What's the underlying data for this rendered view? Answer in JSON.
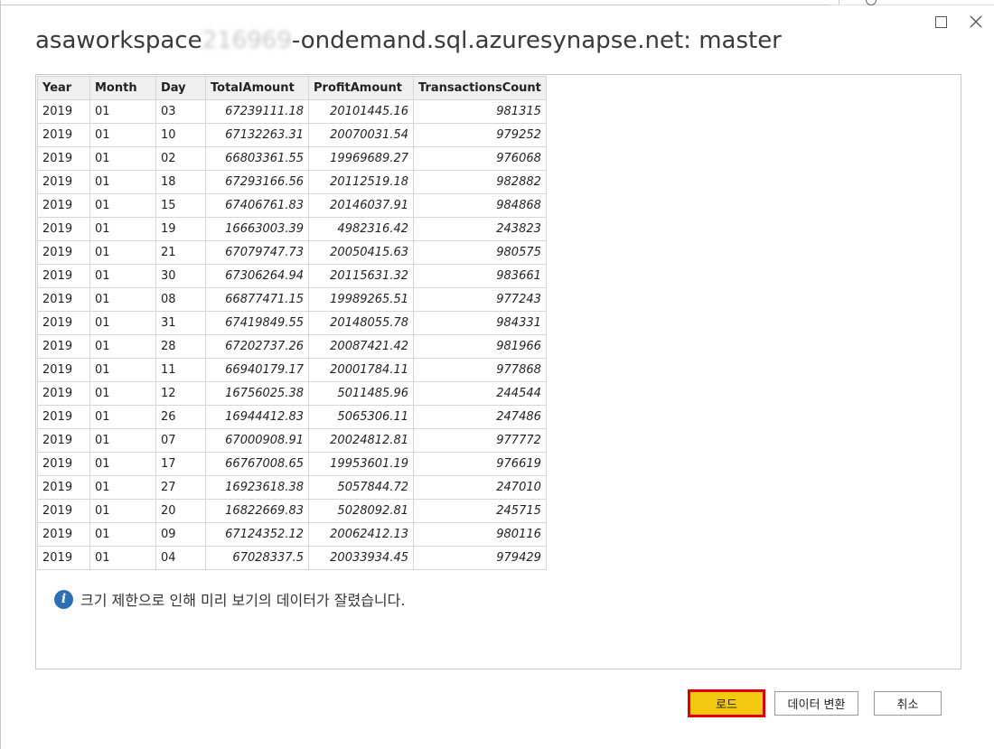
{
  "window": {
    "title_prefix": "asaworkspace",
    "title_redacted": "216969",
    "title_suffix": "-ondemand.sql.azuresynapse.net: master"
  },
  "table": {
    "columns": [
      "Year",
      "Month",
      "Day",
      "TotalAmount",
      "ProfitAmount",
      "TransactionsCount"
    ],
    "rows": [
      [
        "2019",
        "01",
        "03",
        "67239111.18",
        "20101445.16",
        "981315"
      ],
      [
        "2019",
        "01",
        "10",
        "67132263.31",
        "20070031.54",
        "979252"
      ],
      [
        "2019",
        "01",
        "02",
        "66803361.55",
        "19969689.27",
        "976068"
      ],
      [
        "2019",
        "01",
        "18",
        "67293166.56",
        "20112519.18",
        "982882"
      ],
      [
        "2019",
        "01",
        "15",
        "67406761.83",
        "20146037.91",
        "984868"
      ],
      [
        "2019",
        "01",
        "19",
        "16663003.39",
        "4982316.42",
        "243823"
      ],
      [
        "2019",
        "01",
        "21",
        "67079747.73",
        "20050415.63",
        "980575"
      ],
      [
        "2019",
        "01",
        "30",
        "67306264.94",
        "20115631.32",
        "983661"
      ],
      [
        "2019",
        "01",
        "08",
        "66877471.15",
        "19989265.51",
        "977243"
      ],
      [
        "2019",
        "01",
        "31",
        "67419849.55",
        "20148055.78",
        "984331"
      ],
      [
        "2019",
        "01",
        "28",
        "67202737.26",
        "20087421.42",
        "981966"
      ],
      [
        "2019",
        "01",
        "11",
        "66940179.17",
        "20001784.11",
        "977868"
      ],
      [
        "2019",
        "01",
        "12",
        "16756025.38",
        "5011485.96",
        "244544"
      ],
      [
        "2019",
        "01",
        "26",
        "16944412.83",
        "5065306.11",
        "247486"
      ],
      [
        "2019",
        "01",
        "07",
        "67000908.91",
        "20024812.81",
        "977772"
      ],
      [
        "2019",
        "01",
        "17",
        "66767008.65",
        "19953601.19",
        "976619"
      ],
      [
        "2019",
        "01",
        "27",
        "16923618.38",
        "5057844.72",
        "247010"
      ],
      [
        "2019",
        "01",
        "20",
        "16822669.83",
        "5028092.81",
        "245715"
      ],
      [
        "2019",
        "01",
        "09",
        "67124352.12",
        "20062412.13",
        "980116"
      ],
      [
        "2019",
        "01",
        "04",
        "67028337.5",
        "20033934.45",
        "979429"
      ]
    ]
  },
  "notice": {
    "icon": "info-icon",
    "text": "크기 제한으로 인해 미리 보기의 데이터가 잘렸습니다."
  },
  "buttons": {
    "load": "로드",
    "transform": "데이터 변환",
    "cancel": "취소"
  },
  "colors": {
    "load_button": "#f2c811",
    "highlight_border": "#e00000",
    "info_icon": "#2c6fb5"
  }
}
